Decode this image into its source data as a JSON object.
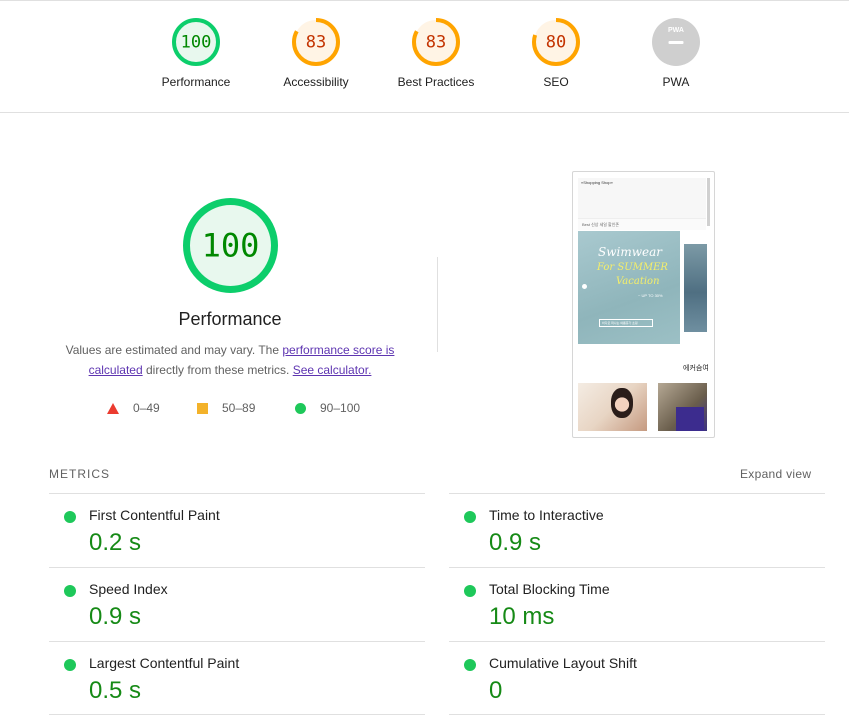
{
  "gauges": [
    {
      "label": "Performance",
      "score": "100",
      "status": "pass",
      "fraction": 1.0
    },
    {
      "label": "Accessibility",
      "score": "83",
      "status": "average",
      "fraction": 0.83
    },
    {
      "label": "Best Practices",
      "score": "83",
      "status": "average",
      "fraction": 0.83
    },
    {
      "label": "SEO",
      "score": "80",
      "status": "average",
      "fraction": 0.8
    },
    {
      "label": "PWA",
      "score": "",
      "status": "na",
      "badge_text": "PWA"
    }
  ],
  "colors": {
    "pass": "#0cce6b",
    "pass_text": "#008800",
    "pass_bg": "#e8f8ee",
    "average": "#ffa400",
    "average_text": "#c33300",
    "average_bg": "#fff4e5",
    "na": "#cccccc"
  },
  "main": {
    "score": "100",
    "title": "Performance",
    "desc_prefix": "Values are estimated and may vary. The ",
    "desc_link1": "performance score is calculated",
    "desc_middle": " directly from these metrics. ",
    "desc_link2": "See calculator."
  },
  "legend": [
    {
      "range": "0–49",
      "shape": "triangle"
    },
    {
      "range": "50–89",
      "shape": "square"
    },
    {
      "range": "90–100",
      "shape": "circle"
    }
  ],
  "thumbnail": {
    "logo": "«Shopping Shop»",
    "nav": "Best   신상   세일   할인존",
    "headline1": "Swimwear",
    "headline2": "For SUMMER",
    "headline3": "Vacation",
    "sub": "~ UP TO 30%",
    "button": "바다로 떠나는 여름휴가 쇼핑",
    "section_title": "에커슴여"
  },
  "metrics": {
    "heading": "METRICS",
    "expand_label": "Expand view",
    "items": [
      {
        "title": "First Contentful Paint",
        "value": "0.2 s",
        "status": "pass"
      },
      {
        "title": "Time to Interactive",
        "value": "0.9 s",
        "status": "pass"
      },
      {
        "title": "Speed Index",
        "value": "0.9 s",
        "status": "pass"
      },
      {
        "title": "Total Blocking Time",
        "value": "10 ms",
        "status": "pass"
      },
      {
        "title": "Largest Contentful Paint",
        "value": "0.5 s",
        "status": "pass"
      },
      {
        "title": "Cumulative Layout Shift",
        "value": "0",
        "status": "pass"
      }
    ]
  }
}
